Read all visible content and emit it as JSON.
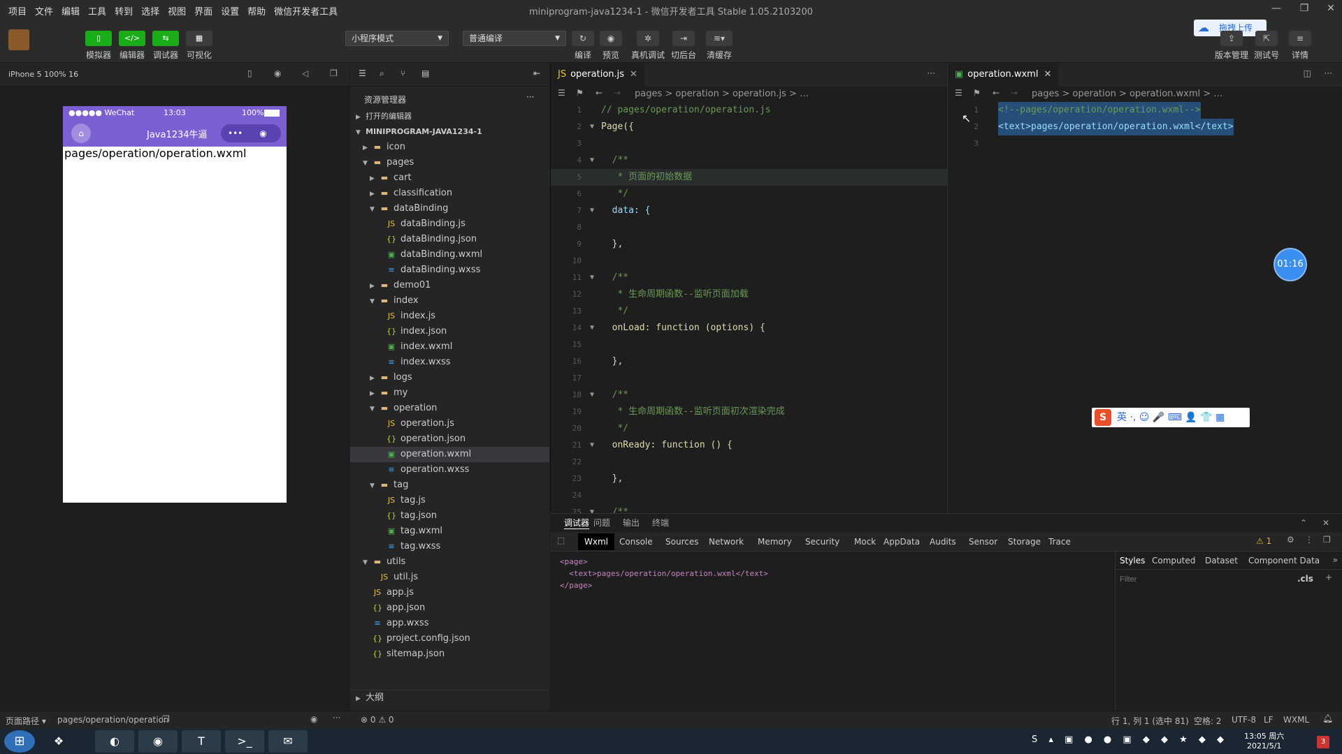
{
  "menu": [
    "项目",
    "文件",
    "编辑",
    "工具",
    "转到",
    "选择",
    "视图",
    "界面",
    "设置",
    "帮助",
    "微信开发者工具"
  ],
  "window_title": "miniprogram-java1234-1 - 微信开发者工具 Stable 1.05.2103200",
  "toolbar": {
    "simulator": "模拟器",
    "editor": "编辑器",
    "debugger": "调试器",
    "visual": "可视化",
    "mode_select": "小程序模式",
    "compile_select": "普通编译",
    "compile": "编译",
    "preview": "预览",
    "remote_debug": "真机调试",
    "background": "切后台",
    "clear_cache": "清缓存",
    "upload_badge": "拖拽上传",
    "version_mgmt": "版本管理",
    "test_no": "测试号",
    "details": "详情"
  },
  "simulator": {
    "device": "iPhone 5 100% 16",
    "carrier": "●●●●● WeChat",
    "time": "13:03",
    "battery": "100%",
    "nav_title": "Java1234牛逼",
    "body_text": "pages/operation/operation.wxml"
  },
  "explorer": {
    "title": "资源管理器",
    "open_editors": "打开的编辑器",
    "project": "MINIPROGRAM-JAVA1234-1",
    "outline": "大纲",
    "items": [
      {
        "label": "icon",
        "depth": 1,
        "type": "folder",
        "open": false
      },
      {
        "label": "pages",
        "depth": 1,
        "type": "folder",
        "open": true
      },
      {
        "label": "cart",
        "depth": 2,
        "type": "folder",
        "open": false
      },
      {
        "label": "classification",
        "depth": 2,
        "type": "folder",
        "open": false
      },
      {
        "label": "dataBinding",
        "depth": 2,
        "type": "folder",
        "open": true
      },
      {
        "label": "dataBinding.js",
        "depth": 3,
        "type": "js"
      },
      {
        "label": "dataBinding.json",
        "depth": 3,
        "type": "json"
      },
      {
        "label": "dataBinding.wxml",
        "depth": 3,
        "type": "wxml"
      },
      {
        "label": "dataBinding.wxss",
        "depth": 3,
        "type": "wxss"
      },
      {
        "label": "demo01",
        "depth": 2,
        "type": "folder",
        "open": false
      },
      {
        "label": "index",
        "depth": 2,
        "type": "folder",
        "open": true
      },
      {
        "label": "index.js",
        "depth": 3,
        "type": "js"
      },
      {
        "label": "index.json",
        "depth": 3,
        "type": "json"
      },
      {
        "label": "index.wxml",
        "depth": 3,
        "type": "wxml"
      },
      {
        "label": "index.wxss",
        "depth": 3,
        "type": "wxss"
      },
      {
        "label": "logs",
        "depth": 2,
        "type": "folder",
        "open": false
      },
      {
        "label": "my",
        "depth": 2,
        "type": "folder",
        "open": false
      },
      {
        "label": "operation",
        "depth": 2,
        "type": "folder",
        "open": true
      },
      {
        "label": "operation.js",
        "depth": 3,
        "type": "js"
      },
      {
        "label": "operation.json",
        "depth": 3,
        "type": "json"
      },
      {
        "label": "operation.wxml",
        "depth": 3,
        "type": "wxml",
        "selected": true
      },
      {
        "label": "operation.wxss",
        "depth": 3,
        "type": "wxss"
      },
      {
        "label": "tag",
        "depth": 2,
        "type": "folder",
        "open": true
      },
      {
        "label": "tag.js",
        "depth": 3,
        "type": "js"
      },
      {
        "label": "tag.json",
        "depth": 3,
        "type": "json"
      },
      {
        "label": "tag.wxml",
        "depth": 3,
        "type": "wxml"
      },
      {
        "label": "tag.wxss",
        "depth": 3,
        "type": "wxss"
      },
      {
        "label": "utils",
        "depth": 1,
        "type": "folder",
        "open": true
      },
      {
        "label": "util.js",
        "depth": 2,
        "type": "js"
      },
      {
        "label": "app.js",
        "depth": 1,
        "type": "js"
      },
      {
        "label": "app.json",
        "depth": 1,
        "type": "json"
      },
      {
        "label": "app.wxss",
        "depth": 1,
        "type": "wxss"
      },
      {
        "label": "project.config.json",
        "depth": 1,
        "type": "json"
      },
      {
        "label": "sitemap.json",
        "depth": 1,
        "type": "json"
      }
    ]
  },
  "editor1": {
    "tab": "operation.js",
    "crumbs": "pages > operation > operation.js > …",
    "lines": [
      {
        "n": "1",
        "t": "// pages/operation/operation.js",
        "c": "c-comment"
      },
      {
        "n": "2",
        "t": "Page({",
        "c": "c-fn",
        "fold": true
      },
      {
        "n": "3",
        "t": "",
        "c": "c-p"
      },
      {
        "n": "4",
        "t": "  /**",
        "c": "c-comment",
        "fold": true
      },
      {
        "n": "5",
        "t": "   * 页面的初始数据",
        "c": "c-comment",
        "hl": true
      },
      {
        "n": "6",
        "t": "   */",
        "c": "c-comment"
      },
      {
        "n": "7",
        "t": "  data: {",
        "c": "c-id",
        "fold": true
      },
      {
        "n": "8",
        "t": "",
        "c": "c-p"
      },
      {
        "n": "9",
        "t": "  },",
        "c": "c-p"
      },
      {
        "n": "10",
        "t": "",
        "c": "c-p"
      },
      {
        "n": "11",
        "t": "  /**",
        "c": "c-comment",
        "fold": true
      },
      {
        "n": "12",
        "t": "   * 生命周期函数--监听页面加载",
        "c": "c-comment"
      },
      {
        "n": "13",
        "t": "   */",
        "c": "c-comment"
      },
      {
        "n": "14",
        "t": "  onLoad: function (options) {",
        "c": "c-fn",
        "fold": true
      },
      {
        "n": "15",
        "t": "",
        "c": "c-p"
      },
      {
        "n": "16",
        "t": "  },",
        "c": "c-p"
      },
      {
        "n": "17",
        "t": "",
        "c": "c-p"
      },
      {
        "n": "18",
        "t": "  /**",
        "c": "c-comment",
        "fold": true
      },
      {
        "n": "19",
        "t": "   * 生命周期函数--监听页面初次渲染完成",
        "c": "c-comment"
      },
      {
        "n": "20",
        "t": "   */",
        "c": "c-comment"
      },
      {
        "n": "21",
        "t": "  onReady: function () {",
        "c": "c-fn",
        "fold": true
      },
      {
        "n": "22",
        "t": "",
        "c": "c-p"
      },
      {
        "n": "23",
        "t": "  },",
        "c": "c-p"
      },
      {
        "n": "24",
        "t": "",
        "c": "c-p"
      },
      {
        "n": "25",
        "t": "  /**",
        "c": "c-comment",
        "fold": true
      }
    ]
  },
  "editor2": {
    "tab": "operation.wxml",
    "crumbs": "pages > operation > operation.wxml > …",
    "lines": [
      {
        "n": "1",
        "t": "<!--pages/operation/operation.wxml-->",
        "c": "c-comment"
      },
      {
        "n": "2",
        "t": "<text>pages/operation/operation.wxml</text>",
        "c": "c-id"
      },
      {
        "n": "3",
        "t": "",
        "c": "c-p"
      }
    ]
  },
  "devtools": {
    "tabs": [
      "调试器",
      "问题",
      "输出",
      "终端"
    ],
    "subtabs": [
      "Wxml",
      "Console",
      "Sources",
      "Network",
      "Memory",
      "Security",
      "Mock",
      "AppData",
      "Audits",
      "Sensor",
      "Storage",
      "Trace"
    ],
    "warn": "⚠ 1",
    "tree": [
      "<page>",
      "  <text>pages/operation/operation.wxml</text>",
      "</page>"
    ],
    "side_tabs": [
      "Styles",
      "Computed",
      "Dataset",
      "Component Data"
    ],
    "filter": "Filter",
    "cls": ".cls"
  },
  "timer": "01:16",
  "ime": "英 ·, ☺ 🎤 ⌨ 👤 👕 ▦",
  "statusbar": {
    "page_path_label": "页面路径 ▾",
    "page_path": "pages/operation/operation",
    "problems": "⊗ 0 ⚠ 0",
    "cursor": "行 1, 列 1 (选中 81)",
    "spaces": "空格: 2",
    "encoding": "UTF-8",
    "eol": "LF",
    "lang": "WXML"
  },
  "taskbar": {
    "time": "13:05 周六",
    "date": "2021/5/1"
  }
}
